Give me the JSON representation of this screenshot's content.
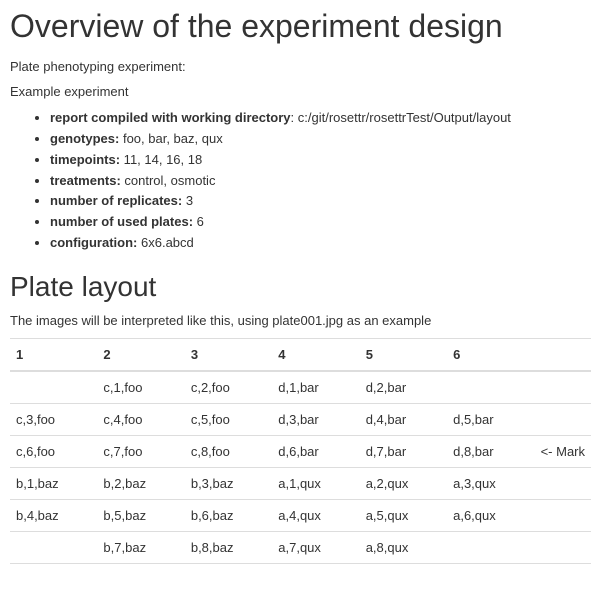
{
  "title": "Overview of the experiment design",
  "intro1": "Plate phenotyping experiment:",
  "intro2": "Example experiment",
  "meta": [
    {
      "label": "report compiled with working directory",
      "value": ": c:/git/rosettr/rosettrTest/Output/layout"
    },
    {
      "label": "genotypes:",
      "value": " foo, bar, baz, qux"
    },
    {
      "label": "timepoints:",
      "value": " 11, 14, 16, 18"
    },
    {
      "label": "treatments:",
      "value": " control, osmotic"
    },
    {
      "label": "number of replicates:",
      "value": " 3"
    },
    {
      "label": "number of used plates:",
      "value": " 6"
    },
    {
      "label": "configuration:",
      "value": " 6x6.abcd"
    }
  ],
  "section2": "Plate layout",
  "section2_desc": "The images will be interpreted like this, using plate001.jpg as an example",
  "table": {
    "headers": [
      "1",
      "2",
      "3",
      "4",
      "5",
      "6",
      ""
    ],
    "rows": [
      [
        "",
        "c,1,foo",
        "c,2,foo",
        "d,1,bar",
        "d,2,bar",
        "",
        ""
      ],
      [
        "c,3,foo",
        "c,4,foo",
        "c,5,foo",
        "d,3,bar",
        "d,4,bar",
        "d,5,bar",
        ""
      ],
      [
        "c,6,foo",
        "c,7,foo",
        "c,8,foo",
        "d,6,bar",
        "d,7,bar",
        "d,8,bar",
        "<- Mark"
      ],
      [
        "b,1,baz",
        "b,2,baz",
        "b,3,baz",
        "a,1,qux",
        "a,2,qux",
        "a,3,qux",
        ""
      ],
      [
        "b,4,baz",
        "b,5,baz",
        "b,6,baz",
        "a,4,qux",
        "a,5,qux",
        "a,6,qux",
        ""
      ],
      [
        "",
        "b,7,baz",
        "b,8,baz",
        "a,7,qux",
        "a,8,qux",
        "",
        ""
      ]
    ]
  }
}
